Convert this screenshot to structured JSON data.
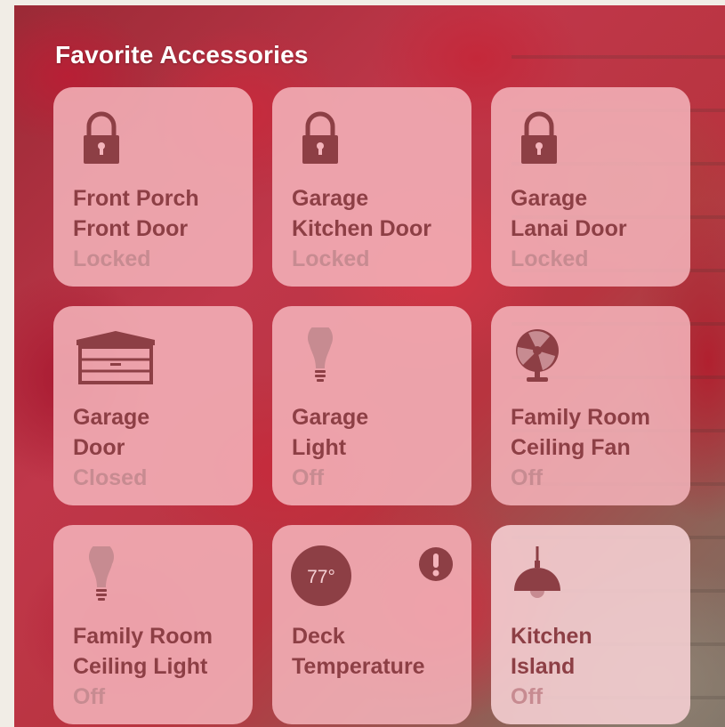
{
  "section_title": "Favorite Accessories",
  "colors": {
    "tile_bg": "#f4b4bb",
    "tile_text": "#8d3f45",
    "tile_status": "#c78b91",
    "icon": "#8d3f45",
    "title": "#ffffff"
  },
  "tiles": [
    {
      "icon": "lock-icon",
      "name": "Front Porch\nFront Door",
      "status": "Locked"
    },
    {
      "icon": "lock-icon",
      "name": "Garage\nKitchen Door",
      "status": "Locked"
    },
    {
      "icon": "lock-icon",
      "name": "Garage\nLanai Door",
      "status": "Locked"
    },
    {
      "icon": "garage-door-icon",
      "name": "Garage\nDoor",
      "status": "Closed"
    },
    {
      "icon": "lightbulb-icon",
      "name": "Garage\nLight",
      "status": "Off"
    },
    {
      "icon": "fan-icon",
      "name": "Family Room\nCeiling Fan",
      "status": "Off"
    },
    {
      "icon": "lightbulb-icon",
      "name": "Family Room\nCeiling Light",
      "status": "Off"
    },
    {
      "icon": "thermometer-badge-icon",
      "name": "Deck\nTemperature",
      "status": "",
      "temperature": "77°",
      "alert_icon": "exclamation-icon"
    },
    {
      "icon": "pendant-lamp-icon",
      "name": "Kitchen\nIsland",
      "status": "Off"
    }
  ]
}
